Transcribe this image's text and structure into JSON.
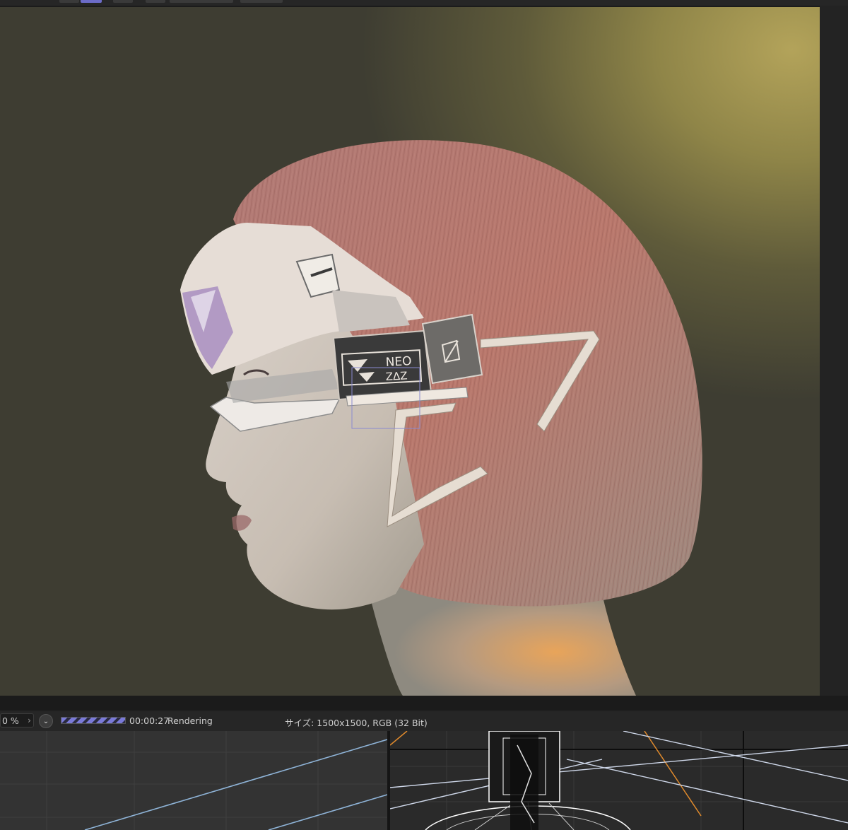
{
  "statusbar": {
    "zoom_value": "0 %",
    "zoom_chevron": "›",
    "menu_icon": "chevron-down-icon",
    "progress_fraction": 0.0,
    "elapsed_time": "00:00:27",
    "status": "Rendering",
    "size_info": "サイズ: 1500x1500, RGB (32 Bit)"
  },
  "render": {
    "badge_line1": "NEO",
    "badge_line2": "ZΔZ"
  },
  "colors": {
    "accent": "#7a7ad8",
    "grid_line": "#8fb4d8",
    "camera_line": "#e08a2c"
  }
}
